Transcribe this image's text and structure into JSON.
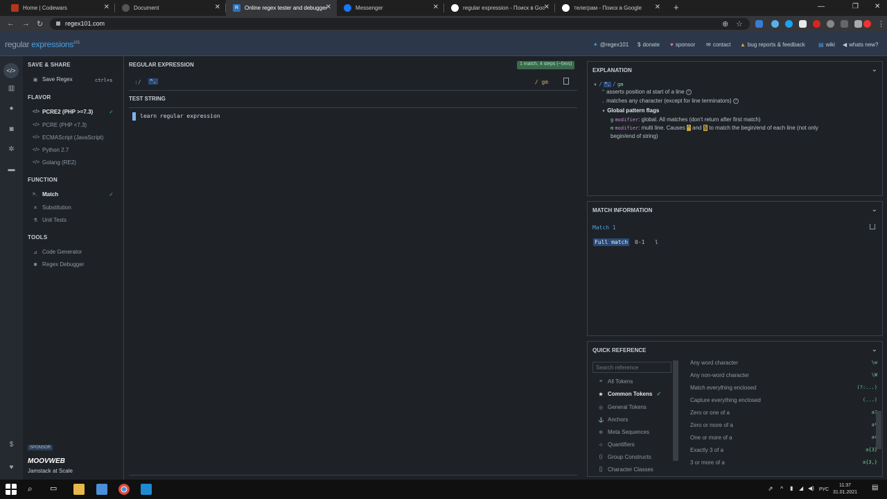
{
  "browser": {
    "tabs": [
      {
        "title": "Home | Codewars",
        "color": "#b1361e",
        "glyph": ""
      },
      {
        "title": "Document",
        "color": "#555",
        "glyph": ""
      },
      {
        "title": "Online regex tester and debugger",
        "color": "#2a73b8",
        "glyph": "R"
      },
      {
        "title": "Messenger",
        "color": "#1877f2",
        "glyph": ""
      },
      {
        "title": "regular expression - Поиск в Google",
        "color": "#ffffff",
        "glyph": ""
      },
      {
        "title": "телеграм - Поиск в Google",
        "color": "#ffffff",
        "glyph": ""
      }
    ],
    "active_tab": 2,
    "url": "regex101.com",
    "new_tab_icon": "plus-icon",
    "window_controls": [
      "minimize-icon",
      "restore-icon",
      "close-icon"
    ]
  },
  "header": {
    "logo_part1": "regular ",
    "logo_part2": "expressions",
    "logo_sup": "101",
    "links": [
      {
        "icon": "twitter-icon",
        "glyph": "🐦",
        "label": "@regex101"
      },
      {
        "icon": "dollar-icon",
        "glyph": "$",
        "label": "donate"
      },
      {
        "icon": "heart-icon",
        "glyph": "♥",
        "label": "sponsor"
      },
      {
        "icon": "mail-icon",
        "glyph": "✉",
        "label": "contact"
      },
      {
        "icon": "warning-icon",
        "glyph": "▲",
        "label": "bug reports & feedback"
      },
      {
        "icon": "book-icon",
        "glyph": "▤",
        "label": "wiki"
      },
      {
        "icon": "megaphone-icon",
        "glyph": "◀",
        "label": "whats new?"
      }
    ]
  },
  "sidebar": {
    "save_share": "SAVE & SHARE",
    "save_regex": "Save Regex",
    "save_shortcut": "ctrl+s",
    "flavor_heading": "FLAVOR",
    "flavors": [
      "PCRE2 (PHP >=7.3)",
      "PCRE (PHP <7.3)",
      "ECMAScript (JavaScript)",
      "Python 2.7",
      "Golang (RE2)"
    ],
    "function_heading": "FUNCTION",
    "functions": [
      "Match",
      "Substitution",
      "Unit Tests"
    ],
    "tools_heading": "TOOLS",
    "tools": [
      "Code Generator",
      "Regex Debugger"
    ],
    "sponsor_tag": "SPONSOR",
    "sponsor_name": "MOOVWEB",
    "sponsor_tagline": "Jamstack at Scale"
  },
  "editor": {
    "regex_label": "REGULAR EXPRESSION",
    "match_badge": "1 match, 4 steps (~0ms)",
    "delimiter_open": ":/",
    "pattern": "^.",
    "flags": "/ gm",
    "test_label": "TEST STRING",
    "test_string": "learn regular expression"
  },
  "explanation": {
    "title": "EXPLANATION",
    "pattern": "^.",
    "flags": "gm",
    "line1_token": "^",
    "line1_text": "asserts position at start of a line",
    "line2_token": ".",
    "line2_text": "matches any character (except for line terminators)",
    "global_flags_title": "Global pattern flags",
    "g_flag": "g",
    "g_modifier": "modifier",
    "g_text": ": global. All matches (don't return after first match)",
    "m_flag": "m",
    "m_modifier": "modifier",
    "m_text_a": ": multi line. Causes",
    "m_caret": "^",
    "m_and": "and",
    "m_dollar": "$",
    "m_text_b": "to match the begin/end of each line (not only",
    "m_text_c": "begin/end of string)"
  },
  "match_info": {
    "title": "MATCH INFORMATION",
    "match_label": "Match 1",
    "full_match": "Full match",
    "range": "0-1",
    "value": "l"
  },
  "quick_reference": {
    "title": "QUICK REFERENCE",
    "search_placeholder": "Search reference",
    "categories": [
      {
        "icon": "list-icon",
        "glyph": "≡",
        "label": "All Tokens"
      },
      {
        "icon": "star-icon",
        "glyph": "★",
        "label": "Common Tokens"
      },
      {
        "icon": "circle-icon",
        "glyph": "◎",
        "label": "General Tokens"
      },
      {
        "icon": "anchor-icon",
        "glyph": "⚓",
        "label": "Anchors"
      },
      {
        "icon": "gear-icon",
        "glyph": "✲",
        "label": "Meta Sequences"
      },
      {
        "icon": "quantifier-icon",
        "glyph": "⊹",
        "label": "Quantifiers"
      },
      {
        "icon": "parens-icon",
        "glyph": "()",
        "label": "Group Constructs"
      },
      {
        "icon": "brackets-icon",
        "glyph": "[]",
        "label": "Character Classes"
      }
    ],
    "selected": 1,
    "rows": [
      {
        "label": "Any word character",
        "token": "\\w"
      },
      {
        "label": "Any non-word character",
        "token": "\\W"
      },
      {
        "label": "Match everything enclosed",
        "token": "(?:...)"
      },
      {
        "label": "Capture everything enclosed",
        "token": "(...)"
      },
      {
        "label": "Zero or one of a",
        "token": "a?"
      },
      {
        "label": "Zero or more of a",
        "token": "a*"
      },
      {
        "label": "One or more of a",
        "token": "a+"
      },
      {
        "label": "Exactly 3 of a",
        "token": "a{3}"
      },
      {
        "label": "3 or more of a",
        "token": "a{3,}"
      }
    ]
  },
  "taskbar": {
    "lang": "РУС",
    "time": "11:37",
    "date": "31.01.2021"
  }
}
